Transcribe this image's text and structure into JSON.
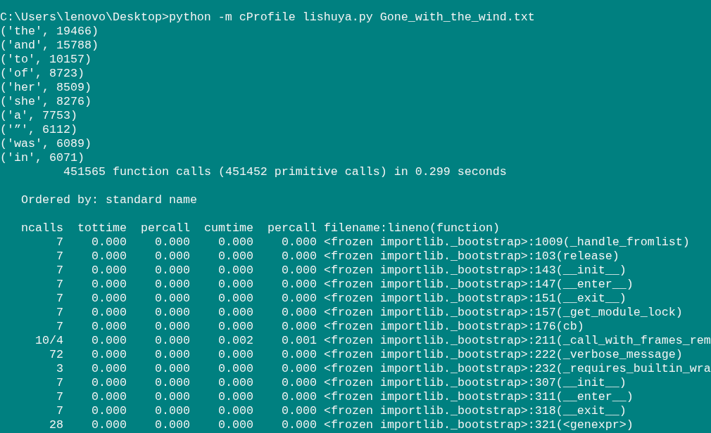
{
  "command_line": "C:\\Users\\lenovo\\Desktop>python -m cProfile lishuya.py Gone_with_the_wind.txt",
  "output_lines": [
    "('the', 19466)",
    "('and', 15788)",
    "('to', 10157)",
    "('of', 8723)",
    "('her', 8509)",
    "('she', 8276)",
    "('a', 7753)",
    "('”', 6112)",
    "('was', 6089)",
    "('in', 6071)"
  ],
  "profile": {
    "summary": "451565 function calls (451452 primitive calls) in 0.299 seconds",
    "ordered_by": "Ordered by: standard name",
    "table": {
      "columns": [
        "ncalls",
        "tottime",
        "percall",
        "cumtime",
        "percall",
        "filename:lineno(function)"
      ],
      "rows": [
        [
          "7",
          "0.000",
          "0.000",
          "0.000",
          "0.000",
          "<frozen importlib._bootstrap>:1009(_handle_fromlist)"
        ],
        [
          "7",
          "0.000",
          "0.000",
          "0.000",
          "0.000",
          "<frozen importlib._bootstrap>:103(release)"
        ],
        [
          "7",
          "0.000",
          "0.000",
          "0.000",
          "0.000",
          "<frozen importlib._bootstrap>:143(__init__)"
        ],
        [
          "7",
          "0.000",
          "0.000",
          "0.000",
          "0.000",
          "<frozen importlib._bootstrap>:147(__enter__)"
        ],
        [
          "7",
          "0.000",
          "0.000",
          "0.000",
          "0.000",
          "<frozen importlib._bootstrap>:151(__exit__)"
        ],
        [
          "7",
          "0.000",
          "0.000",
          "0.000",
          "0.000",
          "<frozen importlib._bootstrap>:157(_get_module_lock)"
        ],
        [
          "7",
          "0.000",
          "0.000",
          "0.000",
          "0.000",
          "<frozen importlib._bootstrap>:176(cb)"
        ],
        [
          "10/4",
          "0.000",
          "0.000",
          "0.002",
          "0.001",
          "<frozen importlib._bootstrap>:211(_call_with_frames_rem"
        ],
        [
          "72",
          "0.000",
          "0.000",
          "0.000",
          "0.000",
          "<frozen importlib._bootstrap>:222(_verbose_message)"
        ],
        [
          "3",
          "0.000",
          "0.000",
          "0.000",
          "0.000",
          "<frozen importlib._bootstrap>:232(_requires_builtin_wra"
        ],
        [
          "7",
          "0.000",
          "0.000",
          "0.000",
          "0.000",
          "<frozen importlib._bootstrap>:307(__init__)"
        ],
        [
          "7",
          "0.000",
          "0.000",
          "0.000",
          "0.000",
          "<frozen importlib._bootstrap>:311(__enter__)"
        ],
        [
          "7",
          "0.000",
          "0.000",
          "0.000",
          "0.000",
          "<frozen importlib._bootstrap>:318(__exit__)"
        ],
        [
          "28",
          "0.000",
          "0.000",
          "0.000",
          "0.000",
          "<frozen importlib._bootstrap>:321(<genexpr>)"
        ]
      ]
    }
  }
}
